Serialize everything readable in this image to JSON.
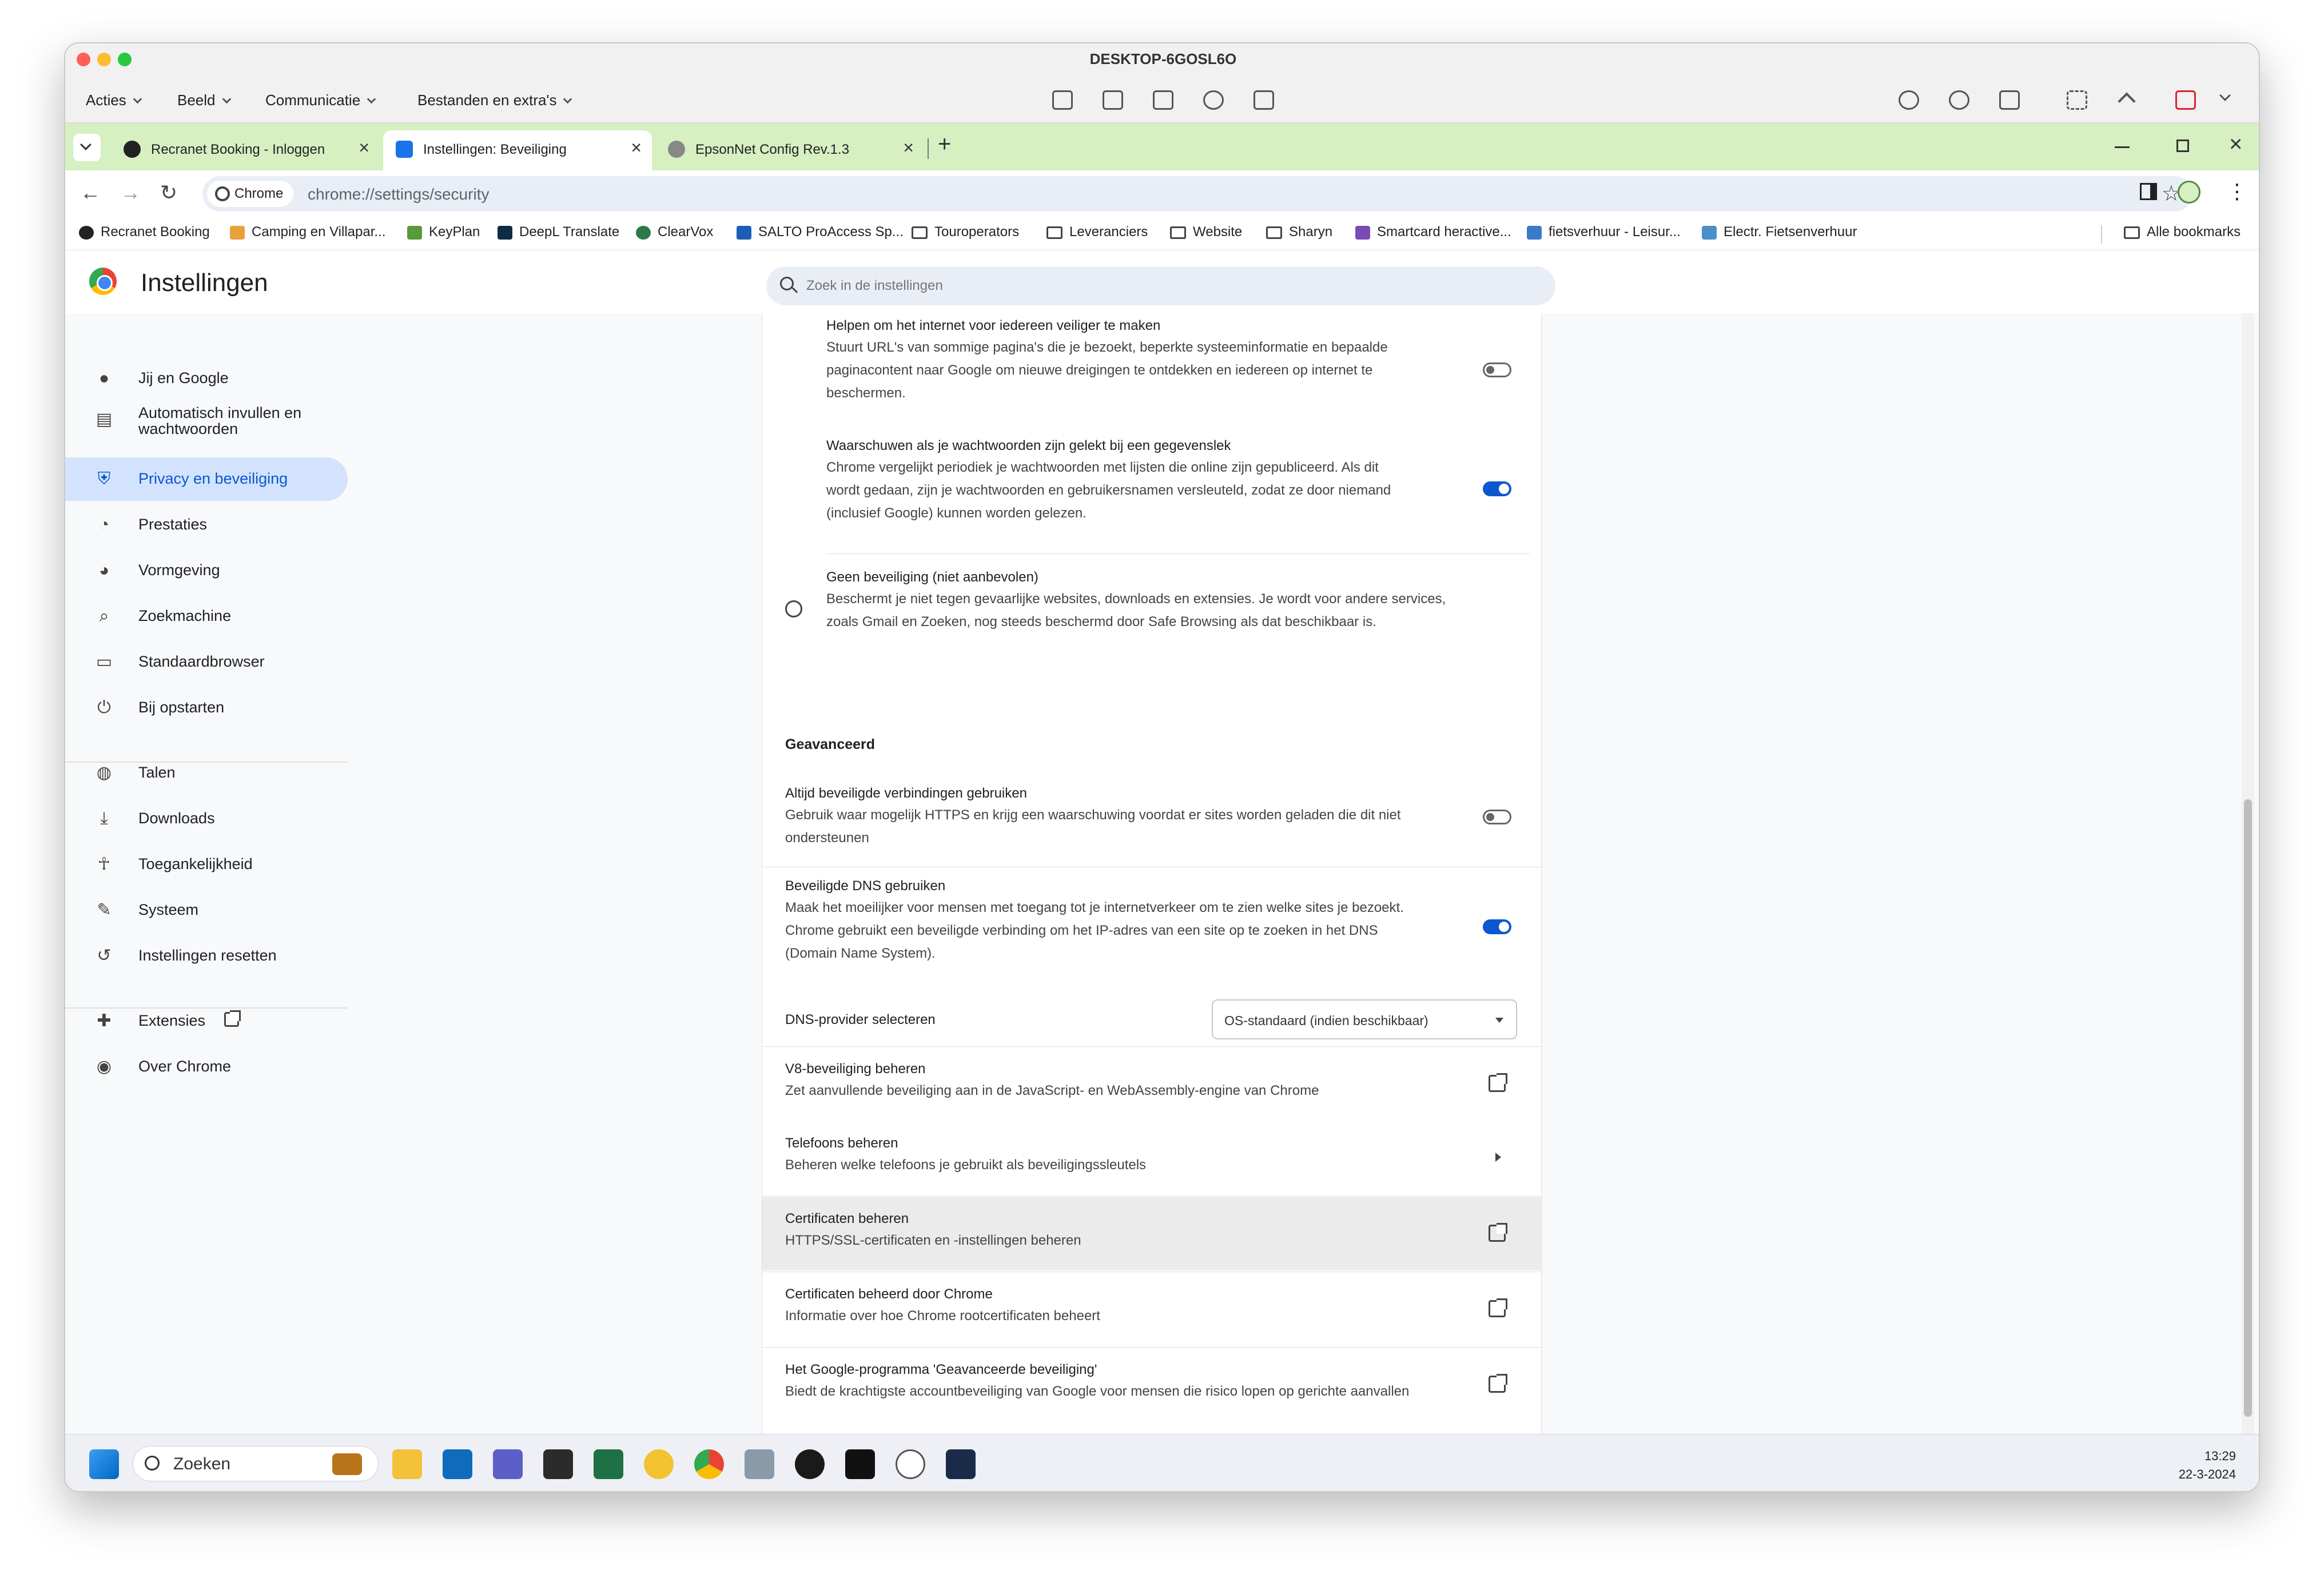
{
  "window": {
    "title": "DESKTOP-6GOSL6O"
  },
  "remote_menu": [
    "Acties",
    "Beeld",
    "Communicatie",
    "Bestanden en extra's"
  ],
  "tabs": [
    {
      "label": "Recranet Booking - Inloggen",
      "icon": "recranet-icon"
    },
    {
      "label": "Instellingen: Beveiliging",
      "icon": "gear-icon"
    },
    {
      "label": "EpsonNet Config Rev.1.3",
      "icon": "globe-icon"
    }
  ],
  "address": {
    "chip": "Chrome",
    "url": "chrome://settings/security"
  },
  "bookmarks": [
    {
      "label": "Recranet Booking",
      "icon": "recranet-icon"
    },
    {
      "label": "Camping en Villapar...",
      "icon": "camping-icon"
    },
    {
      "label": "KeyPlan",
      "icon": "keyplan-icon"
    },
    {
      "label": "DeepL Translate",
      "icon": "deepl-icon"
    },
    {
      "label": "ClearVox",
      "icon": "clearvox-icon"
    },
    {
      "label": "SALTO ProAccess Sp...",
      "icon": "salto-icon"
    },
    {
      "label": "Touroperators",
      "icon": "folder-icon"
    },
    {
      "label": "Leveranciers",
      "icon": "folder-icon"
    },
    {
      "label": "Website",
      "icon": "folder-icon"
    },
    {
      "label": "Sharyn",
      "icon": "folder-icon"
    },
    {
      "label": "Smartcard heractive...",
      "icon": "smartcard-icon"
    },
    {
      "label": "fietsverhuur - Leisur...",
      "icon": "bike-icon"
    },
    {
      "label": "Electr. Fietsenverhuur",
      "icon": "ebike-icon"
    }
  ],
  "all_bookmarks": "Alle bookmarks",
  "settings": {
    "title": "Instellingen",
    "search_placeholder": "Zoek in de instellingen"
  },
  "sidebar": [
    {
      "label": "Jij en Google",
      "icon": "person-icon"
    },
    {
      "label": "Automatisch invullen en wachtwoorden",
      "icon": "clipboard-icon"
    },
    {
      "label": "Privacy en beveiliging",
      "icon": "shield-icon",
      "active": true
    },
    {
      "label": "Prestaties",
      "icon": "speedometer-icon"
    },
    {
      "label": "Vormgeving",
      "icon": "palette-icon"
    },
    {
      "label": "Zoekmachine",
      "icon": "search-icon"
    },
    {
      "label": "Standaardbrowser",
      "icon": "browser-icon"
    },
    {
      "label": "Bij opstarten",
      "icon": "power-icon"
    },
    {
      "label": "Talen",
      "icon": "globe-icon"
    },
    {
      "label": "Downloads",
      "icon": "download-icon"
    },
    {
      "label": "Toegankelijkheid",
      "icon": "accessibility-icon"
    },
    {
      "label": "Systeem",
      "icon": "wrench-icon"
    },
    {
      "label": "Instellingen resetten",
      "icon": "history-icon"
    },
    {
      "label": "Extensies",
      "icon": "puzzle-icon"
    },
    {
      "label": "Over Chrome",
      "icon": "chrome-icon"
    }
  ],
  "content": {
    "help_internet": {
      "title": "Helpen om het internet voor iedereen veiliger te maken",
      "desc1": "Stuurt URL's van sommige pagina's die je bezoekt, beperkte systeeminformatie en bepaalde",
      "desc2": "paginacontent naar Google om nieuwe dreigingen te ontdekken en iedereen op internet te",
      "desc3": "beschermen.",
      "enabled": false
    },
    "password_warning": {
      "title": "Waarschuwen als je wachtwoorden zijn gelekt bij een gegevenslek",
      "desc1": "Chrome vergelijkt periodiek je wachtwoorden met lijsten die online zijn gepubliceerd. Als dit",
      "desc2": "wordt gedaan, zijn je wachtwoorden en gebruikersnamen versleuteld, zodat ze door niemand",
      "desc3": "(inclusief Google) kunnen worden gelezen.",
      "enabled": true
    },
    "no_protection": {
      "title": "Geen beveiliging (niet aanbevolen)",
      "desc1": "Beschermt je niet tegen gevaarlijke websites, downloads en extensies. Je wordt voor andere services,",
      "desc2": "zoals Gmail en Zoeken, nog steeds beschermd door Safe Browsing als dat beschikbaar is."
    },
    "advanced_heading": "Geavanceerd",
    "https": {
      "title": "Altijd beveiligde verbindingen gebruiken",
      "desc1": "Gebruik waar mogelijk HTTPS en krijg een waarschuwing voordat er sites worden geladen die dit niet",
      "desc2": "ondersteunen",
      "enabled": false
    },
    "secure_dns": {
      "title": "Beveiligde DNS gebruiken",
      "desc1": "Maak het moeilijker voor mensen met toegang tot je internetverkeer om te zien welke sites je bezoekt.",
      "desc2": "Chrome gebruikt een beveiligde verbinding om het IP-adres van een site op te zoeken in het DNS",
      "desc3": "(Domain Name System).",
      "enabled": true
    },
    "dns_provider": {
      "label": "DNS-provider selecteren",
      "value": "OS-standaard (indien beschikbaar)"
    },
    "v8": {
      "title": "V8-beveiliging beheren",
      "desc": "Zet aanvullende beveiliging aan in de JavaScript- en WebAssembly-engine van Chrome"
    },
    "phones": {
      "title": "Telefoons beheren",
      "desc": "Beheren welke telefoons je gebruikt als beveiligingssleutels"
    },
    "certs": {
      "title": "Certificaten beheren",
      "desc": "HTTPS/SSL-certificaten en -instellingen beheren"
    },
    "chrome_certs": {
      "title": "Certificaten beheerd door Chrome",
      "desc": "Informatie over hoe Chrome rootcertificaten beheert"
    },
    "advanced_protection": {
      "title": "Het Google-programma 'Geavanceerde beveiliging'",
      "desc": "Biedt de krachtigste accountbeveiliging van Google voor mensen die risico lopen op gerichte aanvallen"
    }
  },
  "taskbar": {
    "search": "Zoeken",
    "time": "13:29",
    "date": "22-3-2024"
  },
  "colors": {
    "accent": "#0b57d0",
    "tabstrip": "#d6f0c2",
    "active_nav": "#d3e3fd"
  }
}
